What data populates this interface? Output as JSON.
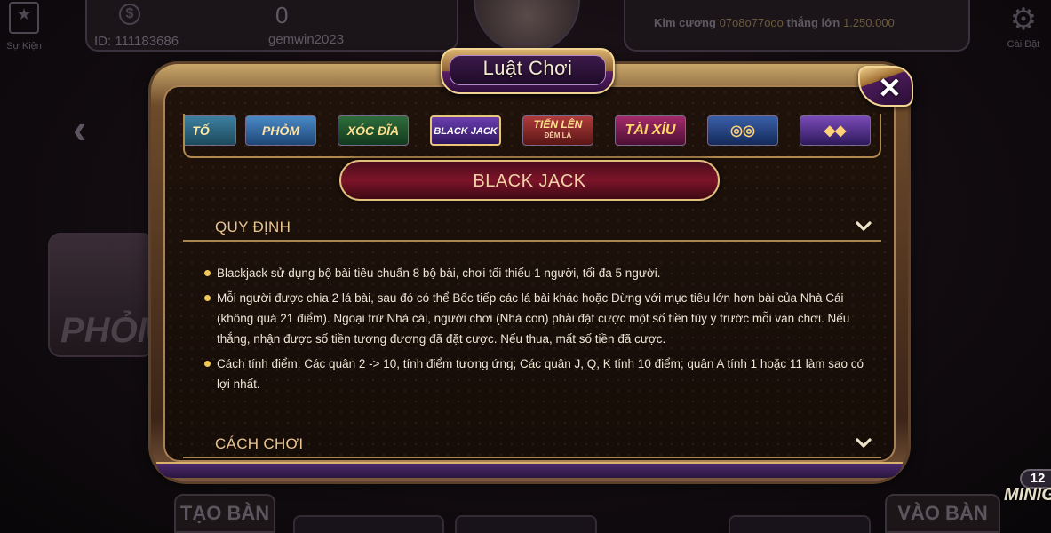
{
  "topbar": {
    "event_label": "Sự Kiện",
    "coin_symbol": "$",
    "user_id": "ID: 111183686",
    "balance": "0",
    "username": "gemwin2023",
    "jackpot_label": "Kim cương",
    "jackpot_phone": "07o8o77ooo",
    "jackpot_win_label": "thắng lớn",
    "jackpot_amount": "1.250.000",
    "settings_label": "Cài Đặt"
  },
  "background": {
    "side_card_text": "PHỎM",
    "create_table": "TẠO BÀN",
    "join_table": "VÀO BÀN",
    "minigame_count": "12",
    "minigame_label": "MINIGA"
  },
  "modal": {
    "title": "Luật Chơi",
    "close_symbol": "✕",
    "game_tabs": [
      {
        "label": "TỐ"
      },
      {
        "label": "PHỎM"
      },
      {
        "label": "XÓC ĐĨA"
      },
      {
        "label": "BLACK JACK"
      },
      {
        "label": "TIẾN LÊN",
        "sub": "ĐẾM LÁ"
      },
      {
        "label": "TÀI XỈU"
      },
      {
        "icon": "slot-machine-icon"
      },
      {
        "icon": "diamond-slot-icon"
      }
    ],
    "selected_game": "BLACK JACK",
    "sections": {
      "rules_title": "QUY ĐỊNH",
      "howto_title": "CÁCH CHƠI"
    },
    "rules": [
      "Blackjack sử dụng bộ bài tiêu chuẩn 8 bộ bài, chơi tối thiểu 1 người, tối đa 5 người.",
      "Mỗi người được chia 2 lá bài, sau đó có thể Bốc tiếp các lá bài khác hoặc Dừng với mục tiêu lớn hơn bài của Nhà Cái (không quá 21 điểm). Ngoại trừ Nhà cái, người chơi (Nhà con) phải đặt cược một số tiền tùy ý trước mỗi ván chơi. Nếu thắng, nhận được số tiền tương đương đã đặt cược. Nếu thua, mất số tiền đã cược.",
      "Cách tính điểm: Các quân 2 -> 10, tính điểm tương ứng; Các quân J, Q, K tính 10 điểm; quân A tính 1 hoặc 11 làm sao có lợi nhất."
    ]
  },
  "colors": {
    "accent_gold": "#e9c591",
    "bullet": "#f0c858",
    "header_red": "#7c1428",
    "frame_purple": "#4b2a6b"
  }
}
